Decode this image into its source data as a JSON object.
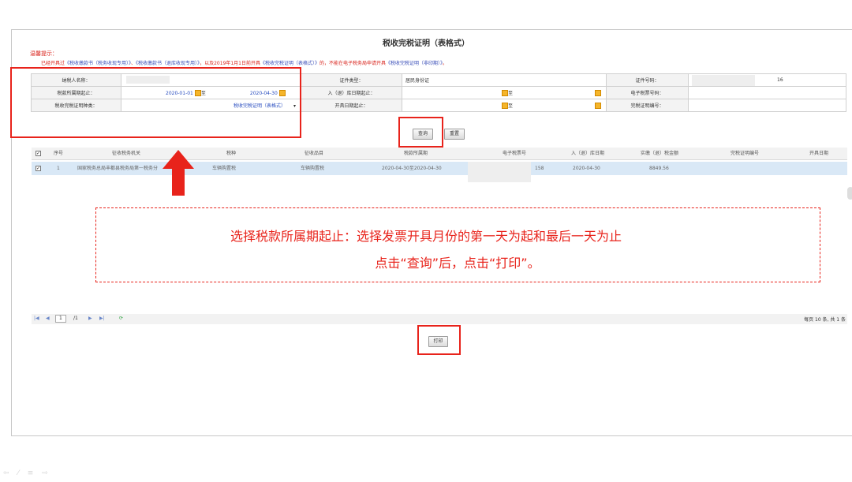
{
  "page": {
    "title": "税收完税证明（表格式）",
    "tip_head": "温馨提示：",
    "tip_text_pre": "已经开具过",
    "tip_link1": "《税收缴款书（税务收现专用）》",
    "tip_sep1": "、",
    "tip_link2": "《税收缴款书（退库收现专用）》",
    "tip_sep2": "，以及2019年1月1日前开具",
    "tip_link3": "《税收完税证明（表格式）》",
    "tip_mid": "的，不能在电子税务局申请开具",
    "tip_link4": "《税收完税证明（非印期）》",
    "tip_end": "。"
  },
  "form": {
    "taxpayer_name_label": "纳税人名称：",
    "cert_type_label": "证件类型：",
    "cert_type_value": "居民身份证",
    "cert_no_label": "证件号码：",
    "cert_no_value_tail": "16",
    "period_label": "税款所属期起止：",
    "period_start": "2020-01-01",
    "period_to": "至",
    "period_end": "2020-04-30",
    "storage_date_label": "入（退）库日期起止：",
    "storage_to": "至",
    "e_ticket_label": "电子税票号码：",
    "proof_type_label": "税收完税证明种类：",
    "proof_type_value": "税收完税证明（表格式）",
    "issue_date_label": "开具日期起止：",
    "issue_to": "至",
    "proof_no_label": "完税证明编号："
  },
  "buttons": {
    "query": "查询",
    "reset": "重置",
    "print": "打印"
  },
  "grid": {
    "headers": [
      "序号",
      "征收税务机关",
      "税种",
      "征收品目",
      "税款所属期",
      "电子税票号",
      "入（退）库日期",
      "实缴（退）税金额",
      "完税证明编号",
      "开具日期"
    ],
    "rows": [
      {
        "no": "1",
        "authority": "国家税务总局丰都县税务局第一税务分",
        "tax_type": "车辆购置税",
        "item": "车辆购置税",
        "period": "2020-04-30至2020-04-30",
        "ticket_no_tail": "158",
        "storage_date": "2020-04-30",
        "amount": "8849.56",
        "proof_no": "",
        "issue_date": ""
      }
    ]
  },
  "pager": {
    "first": "|◀",
    "prev": "◀",
    "page": "1",
    "total_pages": "/1",
    "next": "▶",
    "last": "▶|",
    "refresh": "⟳",
    "summary": "每页 10 条, 共 1 条"
  },
  "annotation": {
    "line1": "选择税款所属期起止：选择发票开具月份的第一天为起和最后一天为止",
    "line2": "点击“查询”后，点击“打印”。"
  },
  "colors": {
    "highlight": "#e8231b",
    "link": "#2b4fc0",
    "row_selected": "#d9e8f6"
  }
}
